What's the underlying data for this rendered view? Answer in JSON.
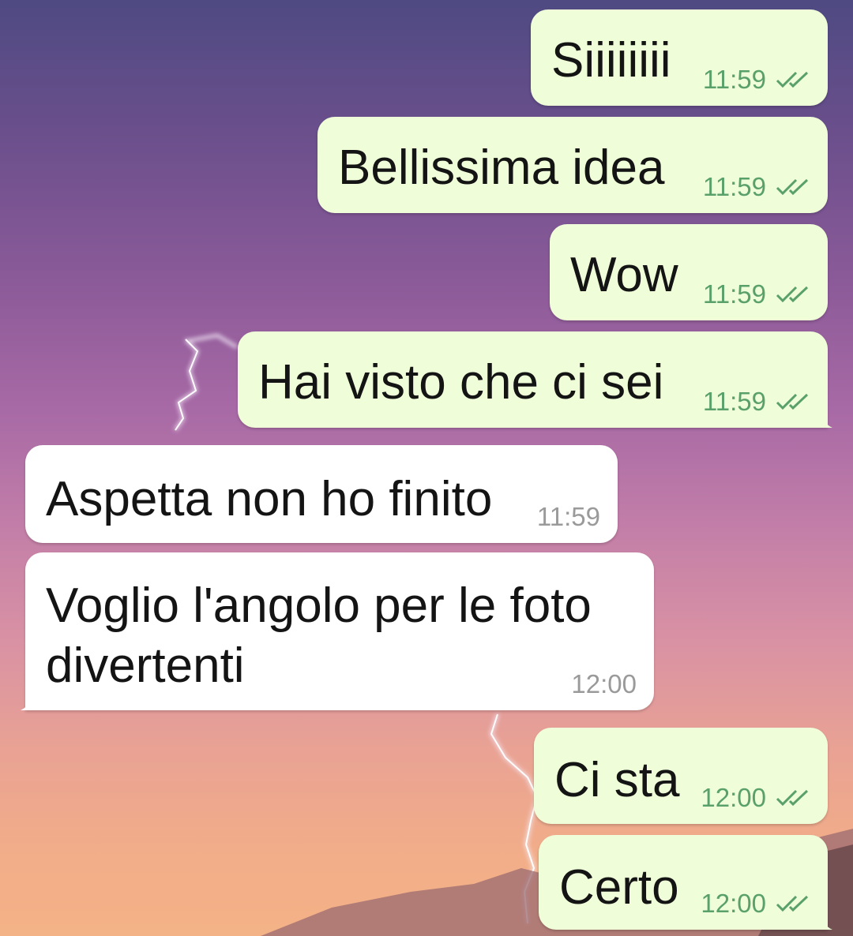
{
  "colors": {
    "outgoing_bubble": "#effed9",
    "incoming_bubble": "#ffffff",
    "outgoing_time": "#5aa06b",
    "incoming_time": "#9a9a9a",
    "read_receipt": "#5aa06b"
  },
  "messages": [
    {
      "direction": "outgoing",
      "text": "Siiiiiiii",
      "time": "11:59",
      "status_icon": "double-check-icon"
    },
    {
      "direction": "outgoing",
      "text": "Bellissima idea",
      "time": "11:59",
      "status_icon": "double-check-icon"
    },
    {
      "direction": "outgoing",
      "text": "Wow",
      "time": "11:59",
      "status_icon": "double-check-icon"
    },
    {
      "direction": "outgoing",
      "text": "Hai visto che ci sei",
      "time": "11:59",
      "status_icon": "double-check-icon"
    },
    {
      "direction": "incoming",
      "text": "Aspetta non ho finito",
      "time": "11:59"
    },
    {
      "direction": "incoming",
      "text": "Voglio l'angolo per le foto divertenti",
      "time": "12:00"
    },
    {
      "direction": "outgoing",
      "text": "Ci sta",
      "time": "12:00",
      "status_icon": "double-check-icon"
    },
    {
      "direction": "outgoing",
      "text": "Certo",
      "time": "12:00",
      "status_icon": "double-check-icon"
    }
  ]
}
